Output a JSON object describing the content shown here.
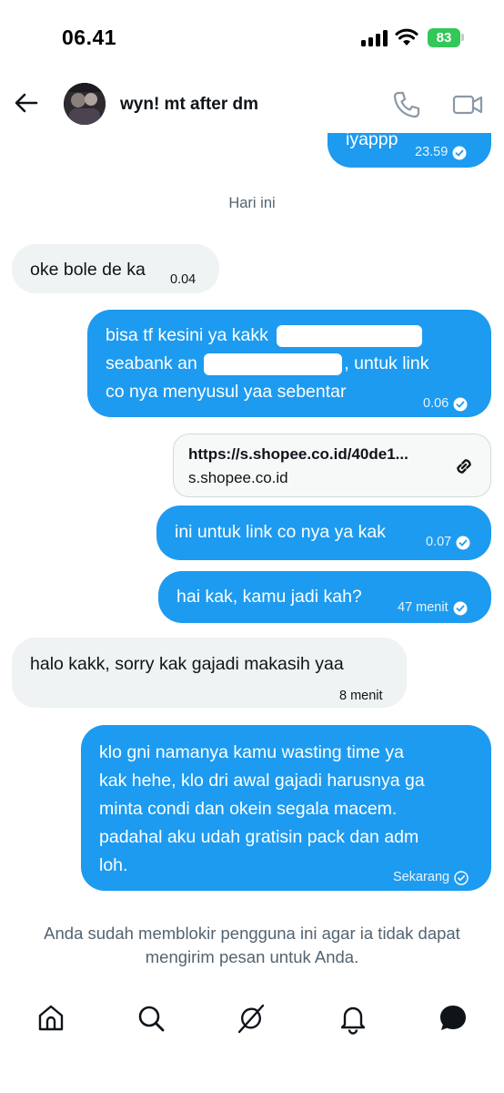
{
  "status_bar": {
    "time": "06.41",
    "battery": "83"
  },
  "header": {
    "name": "wyn! mt after dm",
    "back_icon": "arrow-left-icon",
    "call_icon": "phone-icon",
    "video_icon": "video-icon"
  },
  "messages": {
    "m0": {
      "text": "iyappp",
      "time": "23.59"
    },
    "day_separator": "Hari ini",
    "m1": {
      "text": "oke bole de ka",
      "time": "0.04"
    },
    "m2": {
      "line1": "bisa tf kesini ya kakk",
      "line2a": "seabank an",
      "line2b": ", untuk link",
      "line3": "co nya menyusul yaa sebentar",
      "time": "0.06"
    },
    "link_card": {
      "url": "https://s.shopee.co.id/40de1...",
      "domain": "s.shopee.co.id"
    },
    "m3": {
      "text": "ini untuk link co nya ya kak",
      "time": "0.07"
    },
    "m4": {
      "text": "hai kak, kamu jadi kah?",
      "time": "47 menit"
    },
    "m5": {
      "text": "halo kakk, sorry kak gajadi makasih yaa",
      "time": "8 menit"
    },
    "m6": {
      "line1": "klo gni namanya kamu wasting time ya",
      "line2": "kak hehe, klo dri awal gajadi harusnya ga",
      "line3": "minta condi dan okein segala macem.",
      "line4": "padahal aku udah gratisin pack dan adm",
      "line5": "loh.",
      "time": "Sekarang"
    }
  },
  "blocked_notice": "Anda sudah memblokir pengguna ini agar ia tidak dapat mengirim pesan untuk Anda.",
  "bottom_nav": [
    "home-icon",
    "search-icon",
    "grok-icon",
    "bell-icon",
    "messages-icon"
  ],
  "colors": {
    "sent_bubble": "#1d9bf0",
    "received_bubble": "#eff3f4",
    "secondary_text": "#536471",
    "battery": "#34c759"
  }
}
